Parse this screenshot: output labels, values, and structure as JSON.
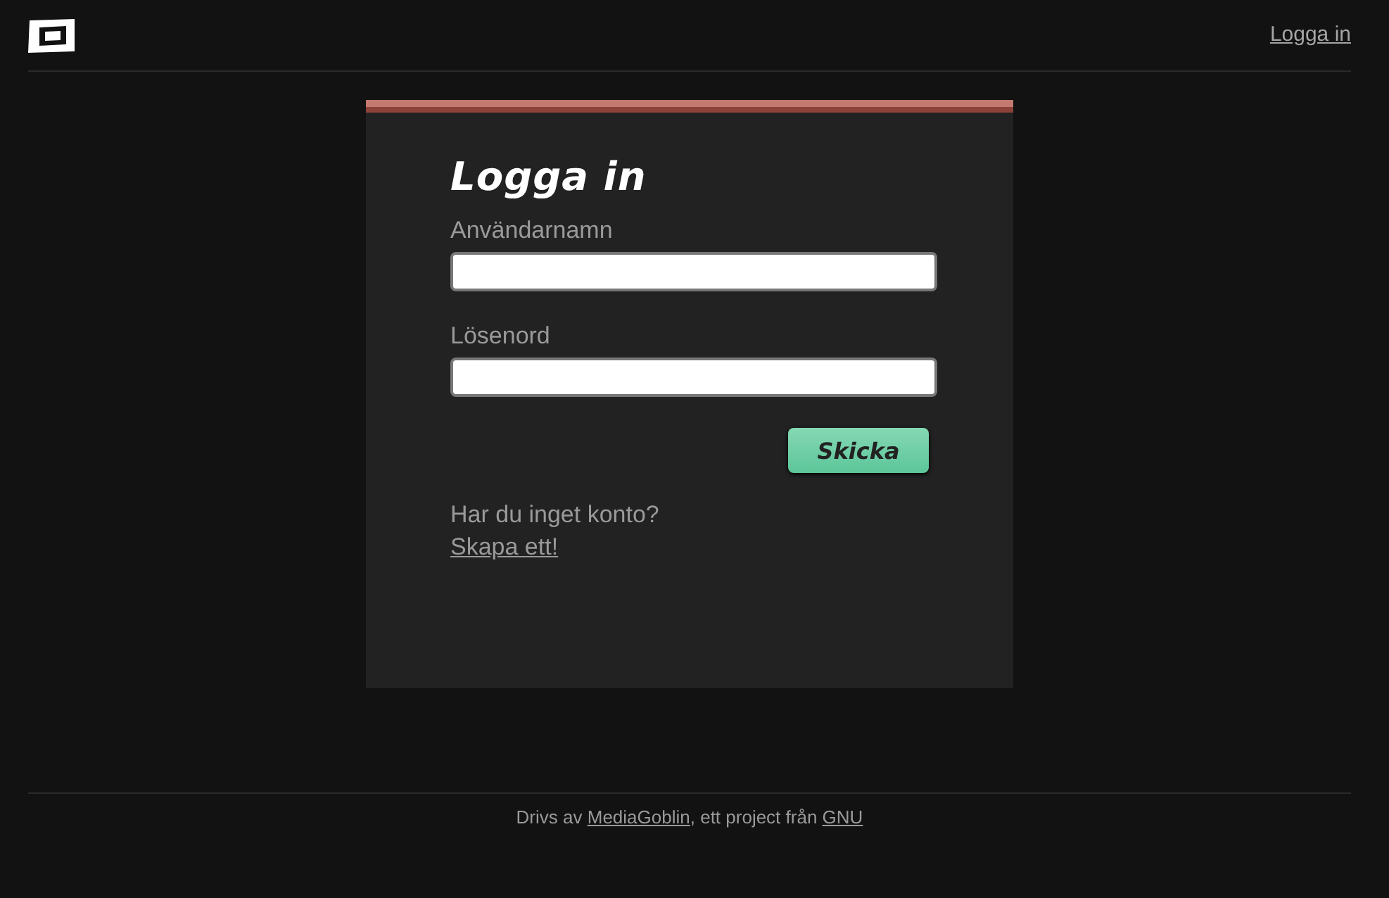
{
  "header": {
    "login_link": "Logga in"
  },
  "form": {
    "title": "Logga in",
    "fields": [
      {
        "label": "Användarnamn"
      },
      {
        "label": "Lösenord"
      }
    ],
    "submit": "Skicka",
    "signup_prompt": "Har du inget konto?",
    "signup_link": "Skapa ett!"
  },
  "footer": {
    "parts": [
      {
        "kind": "text",
        "text": "Drivs av "
      },
      {
        "kind": "link",
        "text": "MediaGoblin"
      },
      {
        "kind": "text",
        "text": ", ett project från "
      },
      {
        "kind": "link",
        "text": "GNU"
      }
    ]
  }
}
